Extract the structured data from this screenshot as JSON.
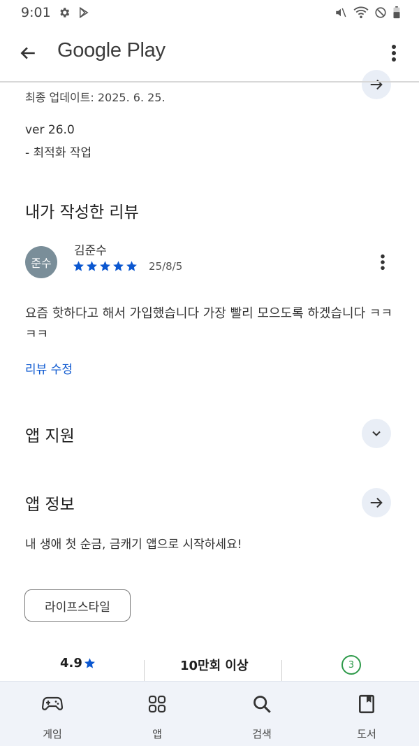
{
  "status_bar": {
    "time": "9:01",
    "icons_left": [
      "gear-icon",
      "play-store-icon"
    ],
    "icons_right": [
      "mute-icon",
      "wifi-icon",
      "do-not-disturb-icon",
      "battery-icon"
    ]
  },
  "app_bar": {
    "title": "Google Play",
    "back_icon": "arrow-left-icon",
    "overflow_icon": "more-vert-icon"
  },
  "whats_new": {
    "last_update": "최종 업데이트: 2025. 6. 25.",
    "version": "ver 26.0",
    "change_note": "- 최적화 작업"
  },
  "my_review": {
    "heading": "내가 작성한 리뷰",
    "avatar_text": "준수",
    "reviewer_name": "김준수",
    "rating": 5,
    "date": "25/8/5",
    "body": "요즘 핫하다고 해서 가입했습니다 가장 빨리 모으도록 하겠습니다 ㅋㅋㅋㅋ",
    "edit_label": "리뷰 수정"
  },
  "app_support": {
    "heading": "앱 지원"
  },
  "app_info": {
    "heading": "앱 정보",
    "description": "내 생애 첫 순금, 금캐기 앱으로 시작하세요!",
    "category_chip": "라이프스타일"
  },
  "stats": {
    "rating": "4.9",
    "downloads": "10만회 이상",
    "age_rating": "3"
  },
  "bottom_nav": {
    "items": [
      {
        "label": "게임",
        "icon": "gamepad-icon"
      },
      {
        "label": "앱",
        "icon": "apps-grid-icon"
      },
      {
        "label": "검색",
        "icon": "search-icon"
      },
      {
        "label": "도서",
        "icon": "book-icon"
      }
    ]
  },
  "colors": {
    "accent_blue": "#0b57d0",
    "star_blue": "#0b57d0",
    "avatar_bg": "#7a8e99",
    "nav_bg": "#f0f3f9",
    "chip_button_bg": "#e9eef6",
    "age_green": "#2e9a4a"
  }
}
